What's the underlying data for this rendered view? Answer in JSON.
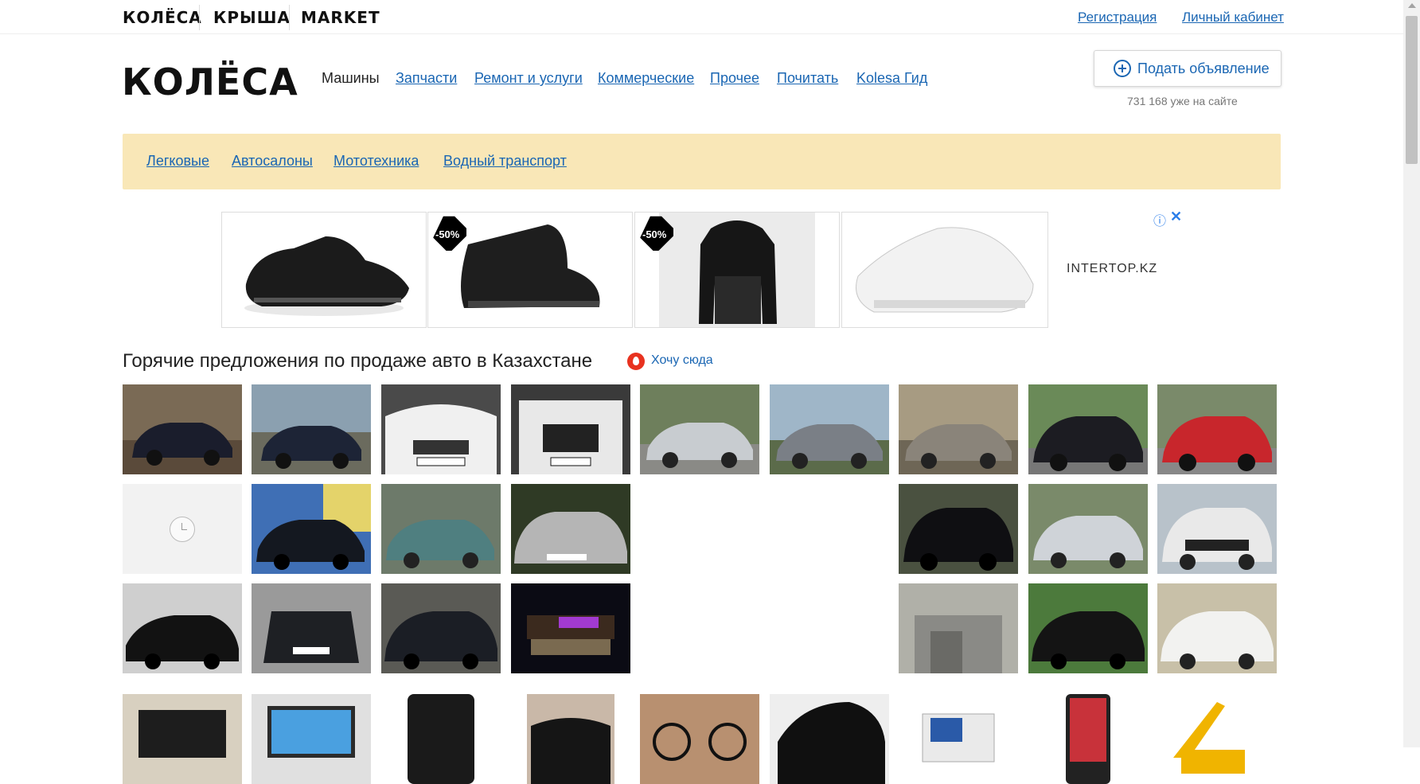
{
  "topbar": {
    "brands": [
      "КОЛЁСА",
      "КРЫША",
      "MARKET"
    ],
    "register": "Регистрация",
    "cabinet": "Личный кабинет"
  },
  "header": {
    "logo": "КОЛЁСА",
    "nav": [
      "Машины",
      "Запчасти",
      "Ремонт и услуги",
      "Коммерческие",
      "Прочее",
      "Почитать",
      "Kolesa Гид"
    ],
    "post_button": "Подать объявление",
    "online_count": "731 168 уже на сайте"
  },
  "subnav": [
    "Легковые",
    "Автосалоны",
    "Мототехника",
    "Водный транспорт"
  ],
  "ad": {
    "badge": "-50%",
    "brand": "INTERTOP.KZ",
    "info_icon": "info-icon",
    "close_icon": "close-icon"
  },
  "hot": {
    "title": "Горячие предложения по продаже авто в Казахстане",
    "want_link": "Хочу сюда"
  },
  "colors": {
    "link": "#1a66b3",
    "subnav_bg": "#f9e7b7",
    "fire": "#e8321f"
  }
}
